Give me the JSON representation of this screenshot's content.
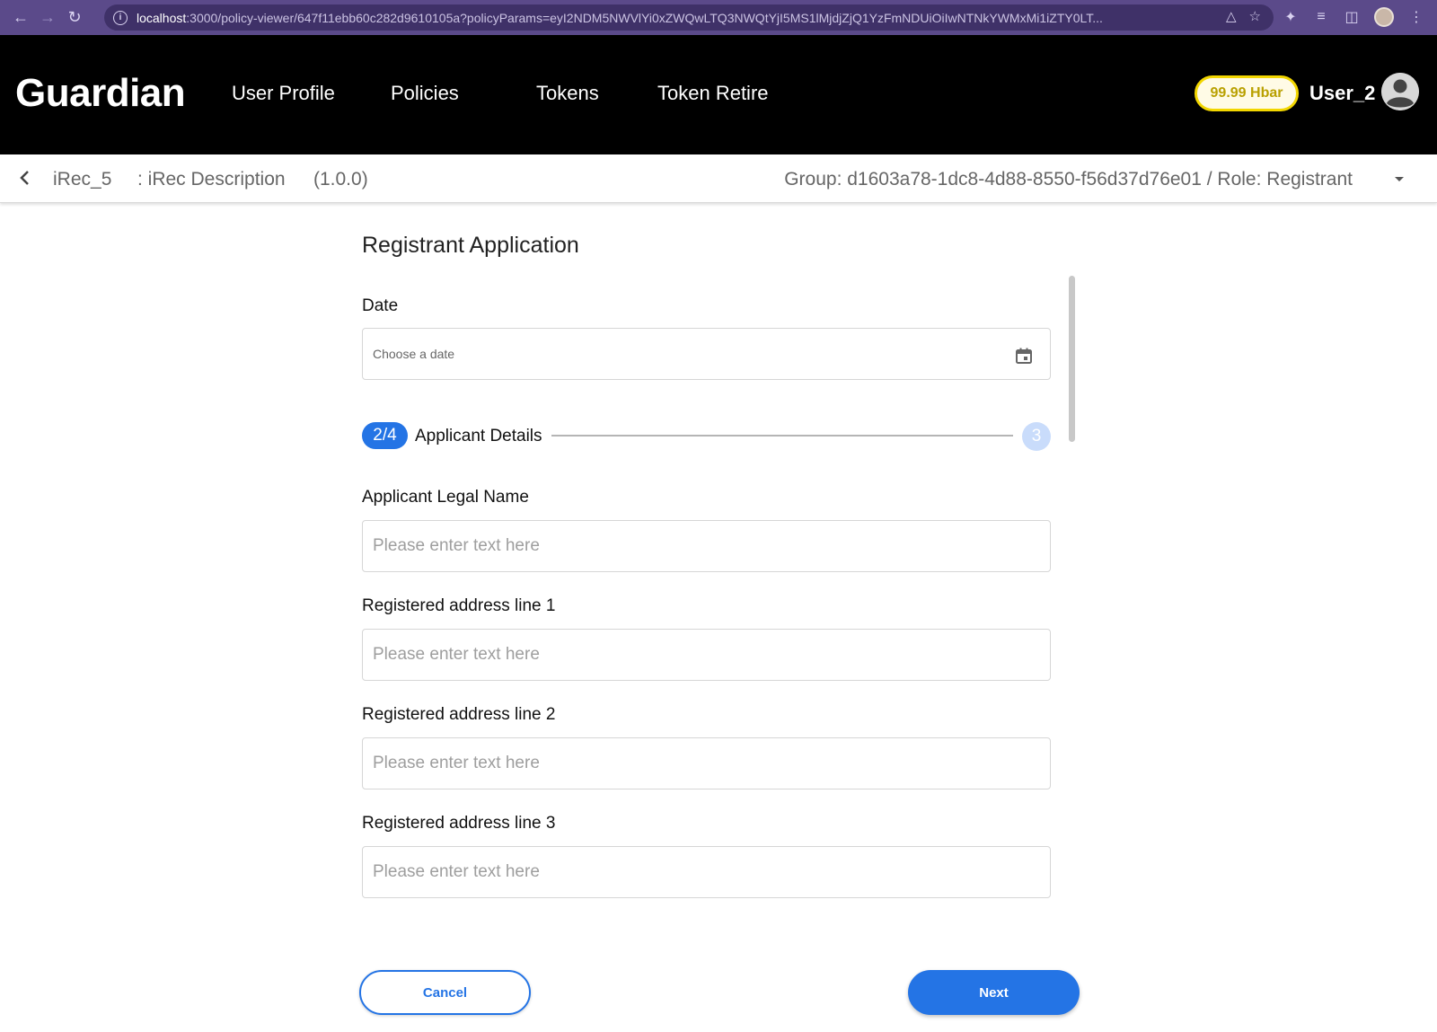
{
  "browser": {
    "url_host": "localhost",
    "url_rest": ":3000/policy-viewer/647f11ebb60c282d9610105a?policyParams=eyI2NDM5NWVlYi0xZWQwLTQ3NWQtYjI5MS1lMjdjZjQ1YzFmNDUiOiIwNTNkYWMxMi1iZTY0LT..."
  },
  "app": {
    "brand": "Guardian",
    "nav": [
      "User Profile",
      "Policies",
      "Tokens",
      "Token Retire"
    ],
    "balance": "99.99 Hbar",
    "username": "User_2"
  },
  "policy": {
    "name": "iRec_5",
    "description": ": iRec Description",
    "version": "(1.0.0)",
    "group_role": "Group: d1603a78-1dc8-4d88-8550-f56d37d76e01 / Role: Registrant"
  },
  "form": {
    "title": "Registrant Application",
    "date_label": "Date",
    "date_placeholder": "Choose a date",
    "step_badge": "2/4",
    "step_title": "Applicant Details",
    "step_next_number": "3",
    "fields": [
      {
        "label": "Applicant Legal Name",
        "placeholder": "Please enter text here"
      },
      {
        "label": "Registered address line 1",
        "placeholder": "Please enter text here"
      },
      {
        "label": "Registered address line 2",
        "placeholder": "Please enter text here"
      },
      {
        "label": "Registered address line 3",
        "placeholder": "Please enter text here"
      }
    ],
    "cancel_label": "Cancel",
    "next_label": "Next"
  }
}
